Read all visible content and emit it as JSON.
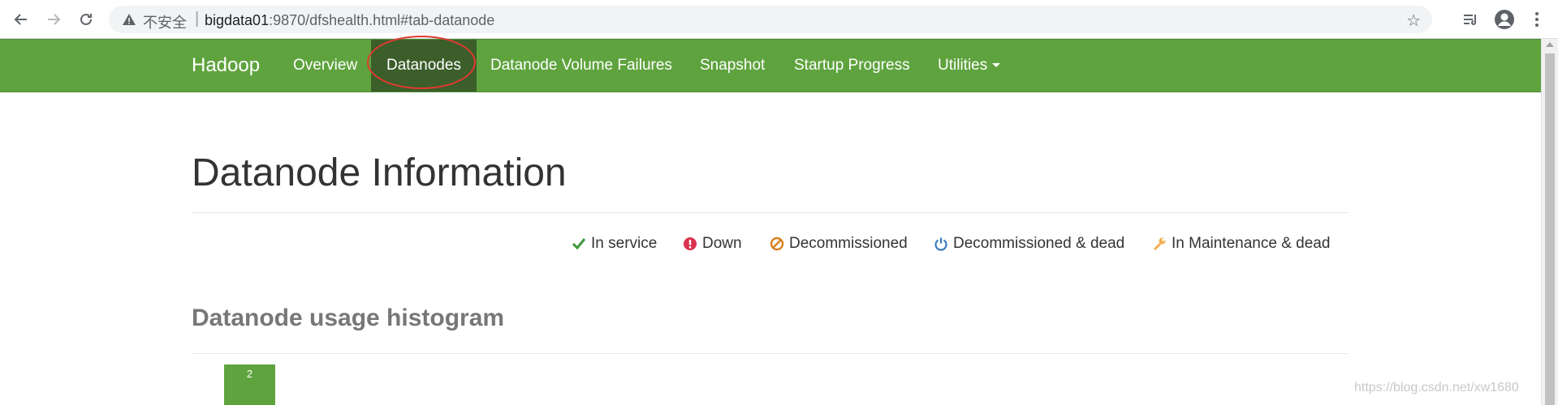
{
  "browser": {
    "security_label": "不安全",
    "url_host": "bigdata01",
    "url_rest": ":9870/dfshealth.html#tab-datanode"
  },
  "navbar": {
    "brand": "Hadoop",
    "items": [
      {
        "label": "Overview"
      },
      {
        "label": "Datanodes"
      },
      {
        "label": "Datanode Volume Failures"
      },
      {
        "label": "Snapshot"
      },
      {
        "label": "Startup Progress"
      },
      {
        "label": "Utilities"
      }
    ],
    "active_item": "Datanodes",
    "color": "#5fa33e",
    "active_color": "#3b5e2a"
  },
  "page": {
    "title": "Datanode Information",
    "legend": [
      {
        "label": "In service",
        "icon": "check-icon",
        "color": "#3c9b3c"
      },
      {
        "label": "Down",
        "icon": "exclamation-circle-icon",
        "color": "#d9334f"
      },
      {
        "label": "Decommissioned",
        "icon": "ban-icon",
        "color": "#d9801e"
      },
      {
        "label": "Decommissioned & dead",
        "icon": "power-icon",
        "color": "#3a7dc1"
      },
      {
        "label": "In Maintenance & dead",
        "icon": "wrench-icon",
        "color": "#f0ad4e"
      }
    ],
    "histogram_title": "Datanode usage histogram",
    "histogram": {
      "bars": [
        {
          "value": 2,
          "label": "2"
        }
      ],
      "color": "#5fa33e"
    }
  },
  "watermark": "https://blog.csdn.net/xw1680"
}
